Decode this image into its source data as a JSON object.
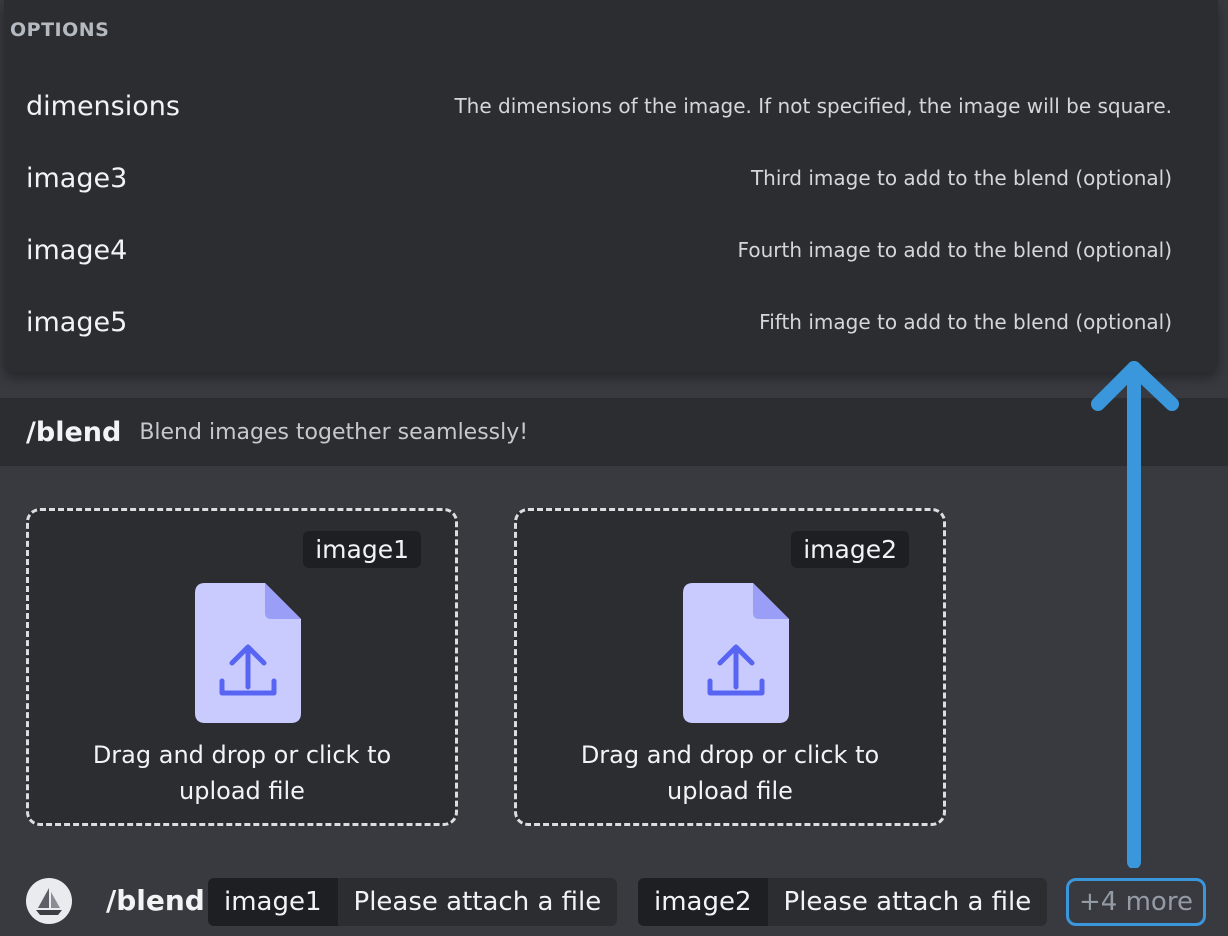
{
  "options": {
    "heading": "OPTIONS",
    "items": [
      {
        "name": "dimensions",
        "description": "The dimensions of the image. If not specified, the image will be square."
      },
      {
        "name": "image3",
        "description": "Third image to add to the blend (optional)"
      },
      {
        "name": "image4",
        "description": "Fourth image to add to the blend (optional)"
      },
      {
        "name": "image5",
        "description": "Fifth image to add to the blend (optional)"
      }
    ]
  },
  "command": {
    "name": "/blend",
    "description": "Blend images together seamlessly!"
  },
  "uploads": [
    {
      "tag": "image1",
      "line1": "Drag and drop or click to",
      "line2": "upload file"
    },
    {
      "tag": "image2",
      "line1": "Drag and drop or click to",
      "line2": "upload file"
    }
  ],
  "input_bar": {
    "command": "/blend",
    "params": [
      {
        "key": "image1",
        "value": "Please attach a file"
      },
      {
        "key": "image2",
        "value": "Please attach a file"
      }
    ],
    "more_label": "+4 more"
  },
  "colors": {
    "accent_blue": "#3a97db",
    "file_icon": "#c9cbff",
    "file_icon_fold": "#9a9ef7",
    "upload_arrow": "#5865f2"
  },
  "icons": {
    "file": "file-upload-icon",
    "avatar": "sailboat-icon",
    "annotation": "arrow-up-icon"
  }
}
